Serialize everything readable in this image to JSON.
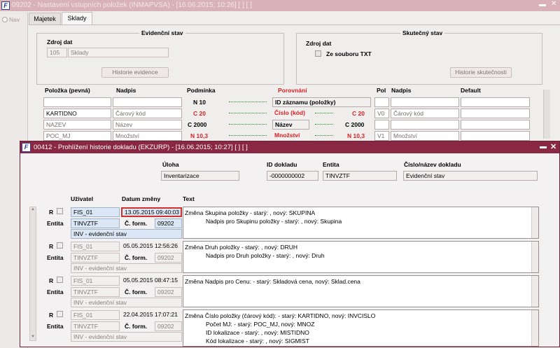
{
  "main_window": {
    "title": "09202 - Nastavení vstupních položek (INMAPVSA) - [16.06.2015; 10:26]  [ ]  [ ]",
    "nav": "Nav",
    "tabs": [
      "Majetek",
      "Sklady"
    ],
    "evid": {
      "title": "Evidenční stav",
      "zdroj_label": "Zdroj dat",
      "zdroj_code": "105",
      "zdroj_name": "Sklady",
      "history_btn": "Historie evidence"
    },
    "skut": {
      "title": "Skutečný stav",
      "zdroj_label": "Zdroj dat",
      "txt_label": "Ze souboru TXT",
      "history_btn": "Historie skutečnosti"
    },
    "cols": {
      "polozka": "Položka  (pevná)",
      "nadpis": "Nadpis",
      "podminka": "Podmínka",
      "porovnani": "Porovnání",
      "pol": "Pol",
      "nadpis2": "Nadpis",
      "default": "Default"
    },
    "rows": [
      {
        "pol": "",
        "nad": "",
        "pod": "N 10",
        "cmp": "ID záznamu (položky)",
        "rcode": "",
        "p2": "",
        "n2": "",
        "red": false
      },
      {
        "pol": "KARTIDNO",
        "nad": "Čárový kód",
        "pod": "C 20",
        "cmp": "Číslo (kód)",
        "rcode": "C 20",
        "p2": "V0",
        "n2": "Čárový kód",
        "red": true
      },
      {
        "pol": "NAZEV",
        "nad": "Název",
        "pod": "C 2000",
        "cmp": "Název",
        "rcode": "C 2000",
        "p2": "",
        "n2": "",
        "red": false
      },
      {
        "pol": "POC_MJ",
        "nad": "Množství",
        "pod": "N 10,3",
        "cmp": "Množství",
        "rcode": "N 10,3",
        "p2": "V1",
        "n2": "Množství",
        "red": true
      }
    ]
  },
  "dialog": {
    "title": "00412 - Prohlížení historie dokladu (EKZURP) - [16.06.2015; 10:27]  [ ]  [ ]",
    "uloha_label": "Úloha",
    "uloha": "Inventarizace",
    "id_label": "ID dokladu",
    "id": "-0000000002",
    "entita_label": "Entita",
    "entita": "TINVZTF",
    "cislo_label": "Číslo/název dokladu",
    "cislo": "Evidenční stav",
    "col_uzivatel": "Uživatel",
    "col_datum": "Datum změny",
    "col_text": "Text",
    "r_label": "R",
    "entita_lbl": "Entita",
    "cform_label": "Č. form.",
    "records": [
      {
        "user": "FIS_01",
        "date": "13.05.2015 09:40:03",
        "entity": "TINVZTF",
        "form": "09202",
        "desc": "INV - evidenční stav",
        "lines": [
          "Změna Skupina položky - starý: , nový: SKUPINA",
          "Nadpis pro Skupinu položky - starý: , nový: Skupina"
        ]
      },
      {
        "user": "FIS_01",
        "date": "05.05.2015 12:56:26",
        "entity": "TINVZTF",
        "form": "09202",
        "desc": "INV - evidenční stav",
        "lines": [
          "Změna Druh položky - starý: , nový: DRUH",
          "Nadpis pro Druh položky - starý: , nový: Druh"
        ]
      },
      {
        "user": "FIS_01",
        "date": "05.05.2015 08:47:15",
        "entity": "TINVZTF",
        "form": "09202",
        "desc": "INV - evidenční stav",
        "lines": [
          "Změna Nadpis pro Cenu:  - starý: Skladová cena, nový: Sklad.cena"
        ]
      },
      {
        "user": "FIS_01",
        "date": "22.04.2015 17:07:21",
        "entity": "TINVZTF",
        "form": "09202",
        "desc": "INV - evidenční stav",
        "lines": [
          "Změna Číslo položky (čárový kód):  - starý: KARTIDNO, nový: INVCISLO",
          "Počet MJ:  - starý: POC_MJ, nový: MNOZ",
          "ID lokalizace - starý: , nový: MISTIDNO",
          "Kód lokalizace - starý: , nový: SIGMIST"
        ]
      }
    ]
  }
}
